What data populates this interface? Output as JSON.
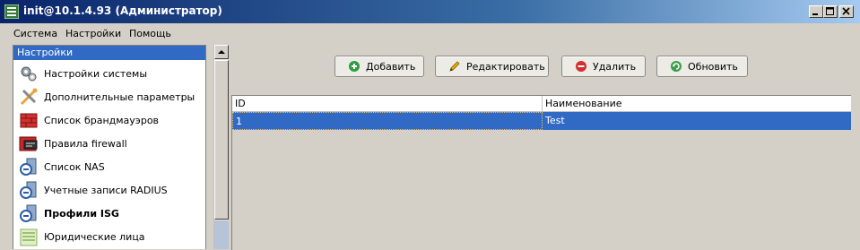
{
  "window": {
    "title": "init@10.1.4.93 (Администратор)"
  },
  "menu": {
    "items": [
      "Система",
      "Настройки",
      "Помощь"
    ]
  },
  "sidebar": {
    "header": "Настройки",
    "items": [
      {
        "label": "Настройки системы",
        "icon": "gears-icon",
        "bold": false
      },
      {
        "label": "Дополнительные параметры",
        "icon": "tools-icon",
        "bold": false
      },
      {
        "label": "Список брандмауэров",
        "icon": "firewall-icon",
        "bold": false
      },
      {
        "label": "Правила firewall",
        "icon": "firewall-rules-icon",
        "bold": false
      },
      {
        "label": "Список NAS",
        "icon": "nas-icon",
        "bold": false
      },
      {
        "label": "Учетные записи RADIUS",
        "icon": "radius-icon",
        "bold": false
      },
      {
        "label": "Профили ISG",
        "icon": "isg-icon",
        "bold": true
      },
      {
        "label": "Юридические лица",
        "icon": "legal-entity-icon",
        "bold": false
      }
    ]
  },
  "toolbar": {
    "add_label": "Добавить",
    "edit_label": "Редактировать",
    "delete_label": "Удалить",
    "refresh_label": "Обновить"
  },
  "table": {
    "columns": [
      "ID",
      "Наименование"
    ],
    "rows": [
      {
        "id": "1",
        "name": "Test",
        "selected": true
      }
    ]
  },
  "colors": {
    "selection": "#316ac5",
    "titlebar": "#0a246a",
    "window_bg": "#d4d0c8"
  }
}
